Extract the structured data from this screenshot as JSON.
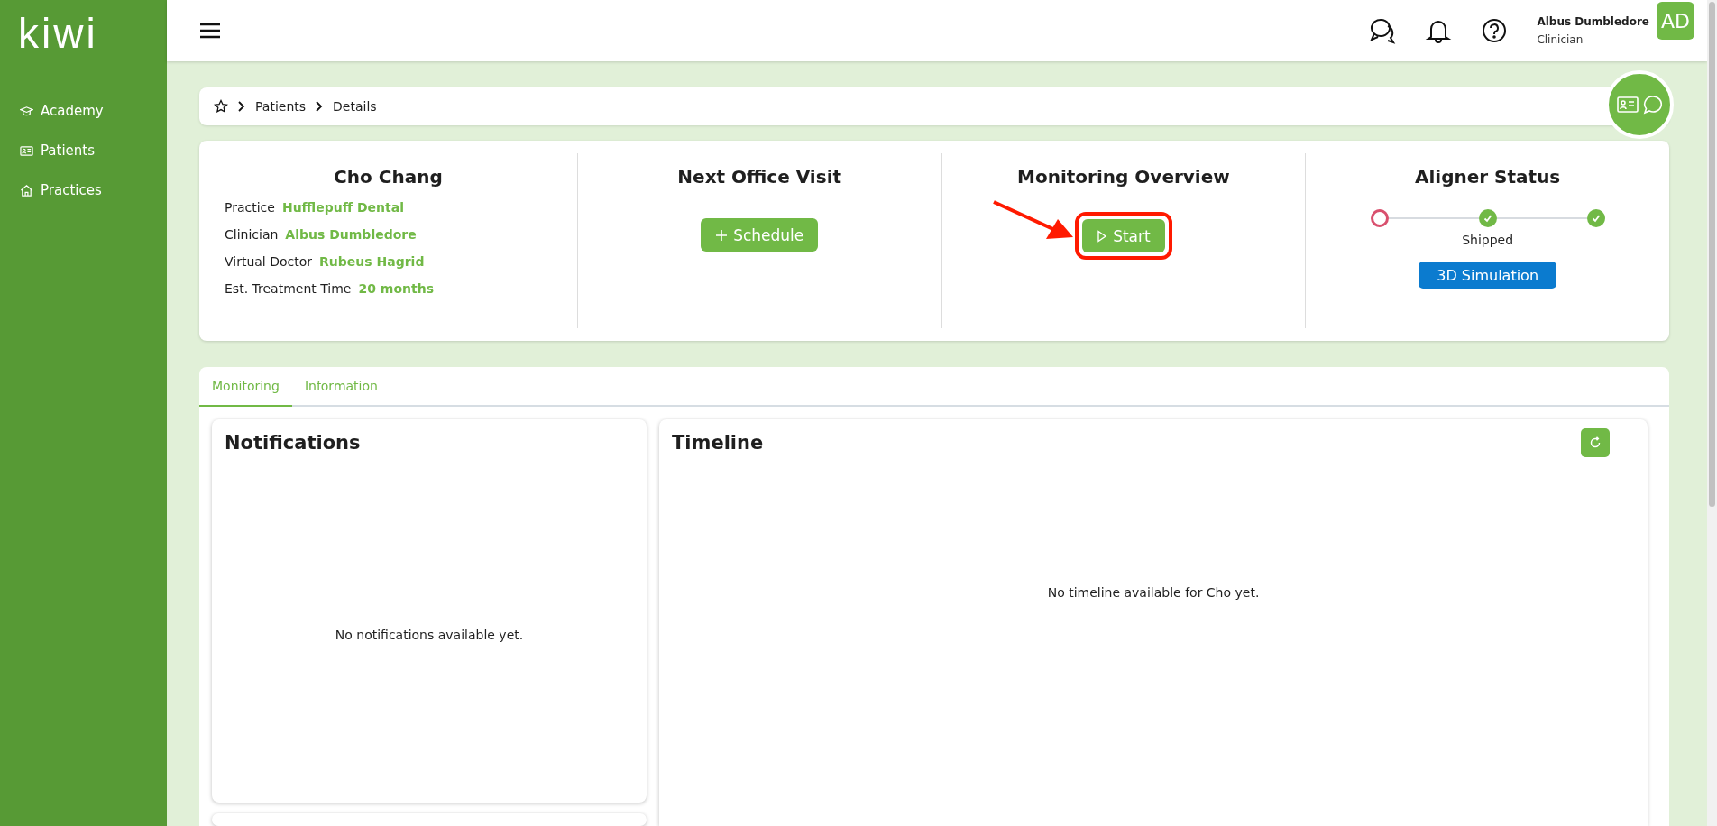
{
  "sidebar": {
    "logo": "kiwi",
    "items": [
      {
        "label": "Academy"
      },
      {
        "label": "Patients"
      },
      {
        "label": "Practices"
      }
    ]
  },
  "header": {
    "user": {
      "name": "Albus Dumbledore",
      "role": "Clinician",
      "initials": "AD"
    }
  },
  "breadcrumb": [
    "Patients",
    "Details"
  ],
  "patient": {
    "name": "Cho Chang",
    "fields": [
      {
        "label": "Practice",
        "value": "Hufflepuff Dental"
      },
      {
        "label": "Clinician",
        "value": "Albus Dumbledore"
      },
      {
        "label": "Virtual Doctor",
        "value": "Rubeus Hagrid"
      },
      {
        "label": "Est. Treatment Time",
        "value": "20 months"
      }
    ]
  },
  "next_visit": {
    "title": "Next Office Visit",
    "button": "Schedule"
  },
  "monitoring": {
    "title": "Monitoring Overview",
    "button": "Start"
  },
  "aligner": {
    "title": "Aligner Status",
    "steps": [
      {
        "checked": false
      },
      {
        "checked": true,
        "label": "Shipped"
      },
      {
        "checked": true
      }
    ],
    "button": "3D Simulation"
  },
  "tabs": [
    {
      "label": "Monitoring",
      "selected": true
    },
    {
      "label": "Information",
      "selected": false
    }
  ],
  "notifications": {
    "title": "Notifications",
    "empty": "No notifications available yet."
  },
  "timeline": {
    "title": "Timeline",
    "empty": "No timeline available for Cho yet."
  }
}
